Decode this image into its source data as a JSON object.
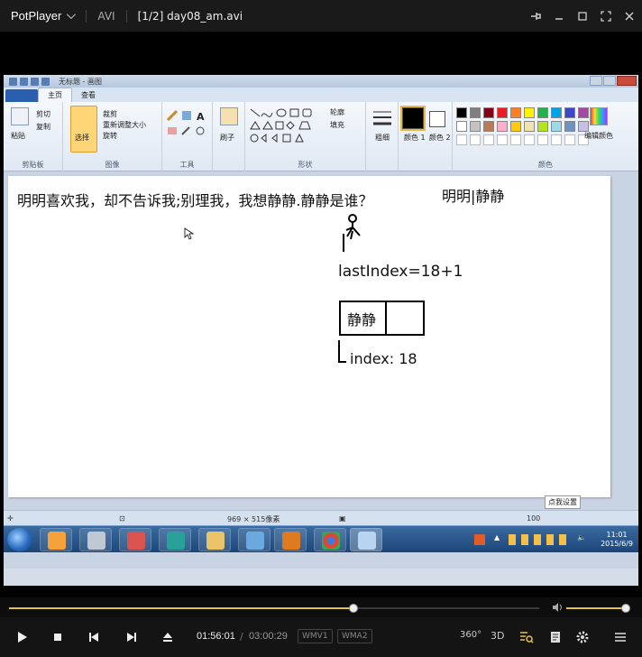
{
  "player": {
    "brand": "PotPlayer",
    "format": "AVI",
    "title": "[1/2] day08_am.avi",
    "progress": 0.65,
    "volume": 1.0,
    "time_current": "01:56:01",
    "time_separator": "/",
    "time_total": "03:00:29",
    "video_codec": "WMV1",
    "audio_codec": "WMA2",
    "icons": {
      "pin": "pin-icon",
      "minimize": "minimize-icon",
      "maximize": "maximize-icon",
      "fullscreen": "fullscreen-icon",
      "close": "close-icon"
    },
    "right_controls": {
      "vr": "360°",
      "stereo": "3D"
    }
  },
  "paint": {
    "window_title": "无标题 - 画图",
    "tabs": [
      "主页",
      "查看"
    ],
    "clipboard": {
      "paste": "粘贴",
      "cut": "剪切",
      "copy": "复制",
      "label": "剪贴板"
    },
    "image": {
      "select": "选择",
      "crop": "裁剪",
      "resize": "重新调整大小",
      "rotate": "旋转",
      "label": "图像"
    },
    "tools_label": "工具",
    "brushes_label": "刷子",
    "shapes": {
      "outline": "轮廓",
      "fill": "填充",
      "label": "形状"
    },
    "size_label": "粗细",
    "color1_label": "颜色 1",
    "color2_label": "颜色 2",
    "edit_colors": "编辑颜色",
    "colors_label": "颜色",
    "palette_row1": [
      "#000000",
      "#7f7f7f",
      "#880015",
      "#ed1c24",
      "#ff7f27",
      "#fff200",
      "#22b14c",
      "#00a2e8",
      "#3f48cc",
      "#a349a4"
    ],
    "palette_row2": [
      "#ffffff",
      "#c3c3c3",
      "#b97a57",
      "#ffaec9",
      "#ffc90e",
      "#efe4b0",
      "#b5e61d",
      "#99d9ea",
      "#7092be",
      "#c8bfe7"
    ],
    "color1": "#000000",
    "color2": "#ffffff",
    "status_size": "969 × 515像素",
    "zoom": "100",
    "tooltip": "点我设置"
  },
  "canvas_text": {
    "line1": "明明喜欢我，却不告诉我;别理我，我想静静.静静是谁？",
    "names": "明明|静静",
    "last_index": "lastIndex=18+1",
    "box_value": "静静",
    "index_label": "index: 18"
  },
  "taskbar": {
    "clock_time": "11:01",
    "clock_date": "2015/6/9"
  }
}
